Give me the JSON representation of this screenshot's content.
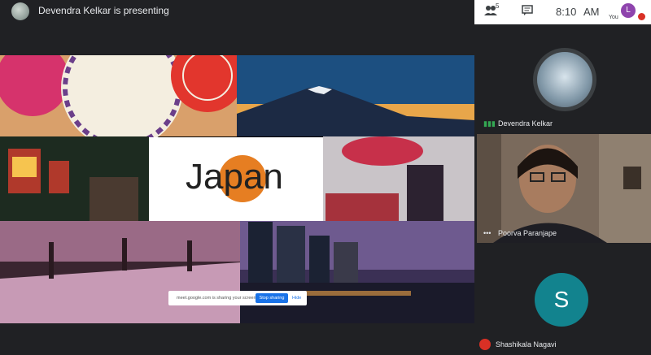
{
  "presenter_bar": {
    "text": "Devendra Kelkar is presenting"
  },
  "header": {
    "people_count": "5",
    "time": "8:10",
    "ampm": "AM",
    "you_initial": "L",
    "you_label": "You"
  },
  "slide": {
    "title": "Japan"
  },
  "share_notice": {
    "message": "meet.google.com is sharing your screen.",
    "stop_label": "Stop sharing",
    "hide_label": "Hide"
  },
  "participants": [
    {
      "name": "Devendra Kelkar",
      "status": "speaking"
    },
    {
      "name": "Poorva Paranjape",
      "status": "active"
    },
    {
      "name": "Shashikala Nagavi",
      "initial": "S",
      "status": "muted"
    }
  ],
  "colors": {
    "bg": "#202124",
    "accent_blue": "#1a73e8",
    "mute_red": "#d93025",
    "avatar_teal": "#12838e",
    "speaking_green": "#34a853",
    "japan_circle": "#e67e22"
  }
}
